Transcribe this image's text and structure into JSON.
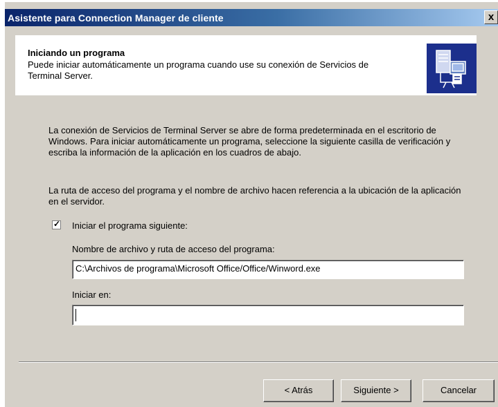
{
  "window": {
    "title": "Asistente para Connection Manager de cliente",
    "close_glyph": "x"
  },
  "header": {
    "title": "Iniciando un programa",
    "description": "Puede iniciar automáticamente un programa cuando use su conexión de Servicios de Terminal Server.",
    "icon": "terminal-server-connection-icon"
  },
  "body": {
    "paragraph1": "La conexión de Servicios de Terminal Server se abre de forma predeterminada en el escritorio de Windows. Para iniciar automáticamente un programa, seleccione la siguiente casilla de verificación y escriba la información de la aplicación en los cuadros de abajo.",
    "paragraph2": "La ruta de acceso del programa y el nombre de archivo hacen referencia a la ubicación de la aplicación en el servidor.",
    "checkbox": {
      "label": "Iniciar el programa siguiente:",
      "checked": true,
      "check_glyph": "✓"
    },
    "program_path": {
      "label": "Nombre de archivo y ruta de acceso del programa:",
      "value": "C:\\Archivos de programa\\Microsoft Office/Office/Winword.exe"
    },
    "start_in": {
      "label": "Iniciar en:",
      "value": ""
    }
  },
  "buttons": {
    "back": "< Atrás",
    "next": "Siguiente >",
    "cancel": "Cancelar"
  },
  "colors": {
    "title_gradient_start": "#0a246a",
    "title_gradient_end": "#a6caf0",
    "dialog_face": "#d4d0c8",
    "icon_background": "#1c2f8c"
  }
}
